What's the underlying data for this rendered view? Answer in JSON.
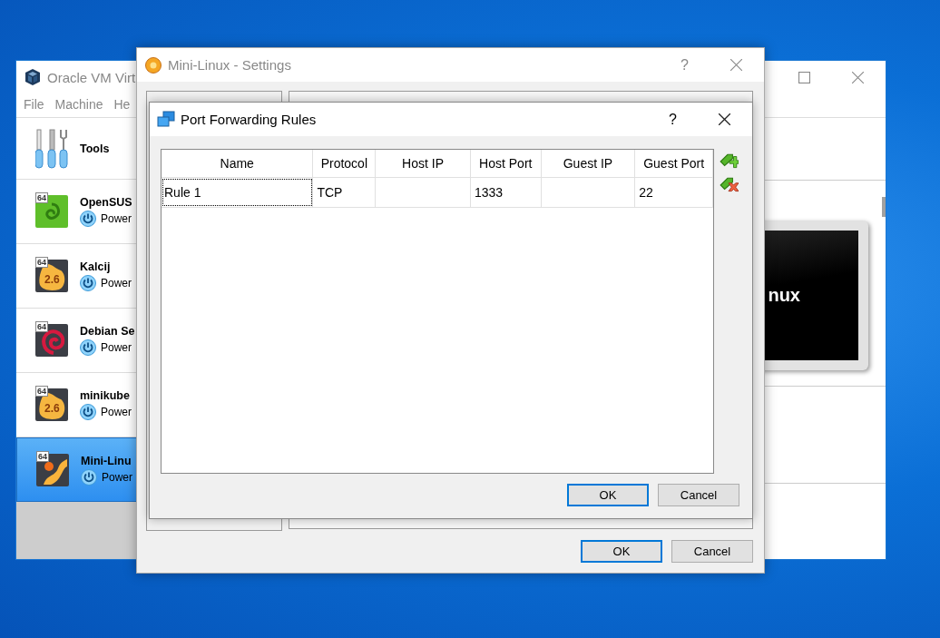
{
  "main_window": {
    "title": "Oracle VM Virt",
    "menu": [
      "File",
      "Machine",
      "He"
    ],
    "tools": {
      "label": "Tools"
    },
    "machines": [
      {
        "name": "OpenSUS",
        "state": "Power",
        "badge": "64",
        "kind": "spiral",
        "selected": false
      },
      {
        "name": "Kalcij",
        "state": "Power",
        "badge": "64",
        "kind": "blob",
        "version": "2.6",
        "selected": false
      },
      {
        "name": "Debian Se",
        "state": "Power",
        "badge": "64",
        "kind": "swirl",
        "selected": false
      },
      {
        "name": "minikube",
        "state": "Power",
        "badge": "64",
        "kind": "blob",
        "version": "2.6",
        "selected": false
      },
      {
        "name": "Mini-Linu",
        "state": "Power",
        "badge": "64",
        "kind": "curve",
        "selected": true
      }
    ],
    "preview": {
      "text": "nux"
    }
  },
  "settings_window": {
    "title": "Mini-Linux - Settings",
    "help": "?",
    "buttons": [
      {
        "label": "OK",
        "default": true
      },
      {
        "label": "Cancel",
        "default": false
      }
    ]
  },
  "port_forwarding_dialog": {
    "title": "Port Forwarding Rules",
    "help": "?",
    "table": {
      "columns": [
        "Name",
        "Protocol",
        "Host IP",
        "Host Port",
        "Guest IP",
        "Guest Port"
      ],
      "rows": [
        {
          "cells": [
            "Rule 1",
            "TCP",
            null,
            "1333",
            null,
            "22"
          ],
          "focused": true
        }
      ]
    },
    "buttons": [
      {
        "label": "OK",
        "default": true
      },
      {
        "label": "Cancel",
        "default": false
      }
    ]
  }
}
